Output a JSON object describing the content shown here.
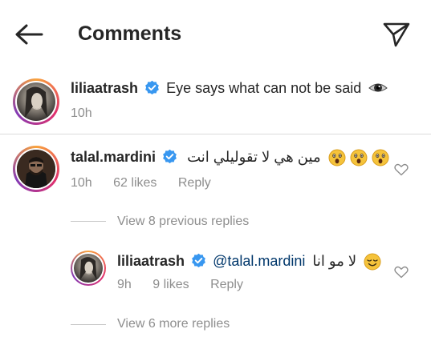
{
  "header": {
    "title": "Comments"
  },
  "caption": {
    "username": "liliaatrash",
    "text": "Eye says what can not be said",
    "time": "10h"
  },
  "comment": {
    "username": "talal.mardini",
    "text": "مين هي لا تقوليلي انت",
    "time": "10h",
    "likes": "62 likes",
    "reply_label": "Reply"
  },
  "view_previous": "View 8 previous replies",
  "reply": {
    "username": "liliaatrash",
    "mention": "@talal.mardini",
    "text": "لا مو انا",
    "time": "9h",
    "likes": "9 likes",
    "reply_label": "Reply"
  },
  "view_more": "View 6 more replies",
  "icons": {
    "back": "arrow-left-icon",
    "send": "paper-plane-icon",
    "verified": "verified-badge-icon",
    "eye": "eye-icon",
    "heart": "heart-icon",
    "emoji_astonished": "astonished-face-icon",
    "emoji_relieved": "relieved-face-icon"
  },
  "colors": {
    "verified_blue": "#3897f0",
    "story_ring_gradient": [
      "#f9a23c",
      "#e1306c",
      "#833ab4"
    ],
    "mention": "#00376b",
    "muted": "#8e8e8e"
  }
}
